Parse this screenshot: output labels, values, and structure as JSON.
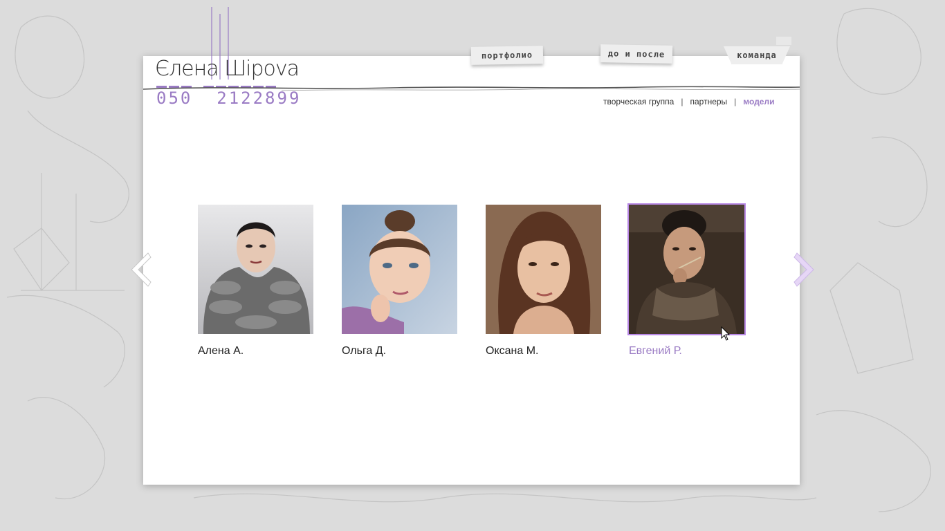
{
  "logo": {
    "name": "Єлена Шipova",
    "phone": "050  2122899"
  },
  "tabs": [
    {
      "label": "портфолио"
    },
    {
      "label": "до и после"
    },
    {
      "label": "команда"
    }
  ],
  "subnav": {
    "items": [
      {
        "label": "творческая группа",
        "active": false
      },
      {
        "label": "партнеры",
        "active": false
      },
      {
        "label": "модели",
        "active": true
      }
    ],
    "separator": "|"
  },
  "gallery": {
    "models": [
      {
        "name": "Алена А.",
        "active": false
      },
      {
        "name": "Ольга Д.",
        "active": false
      },
      {
        "name": "Оксана М.",
        "active": false
      },
      {
        "name": "Евгений Р.",
        "active": true
      }
    ]
  },
  "colors": {
    "accent": "#9a7bc4",
    "active_border": "#b888e6",
    "background": "#dcdcdc",
    "panel": "#ffffff"
  }
}
